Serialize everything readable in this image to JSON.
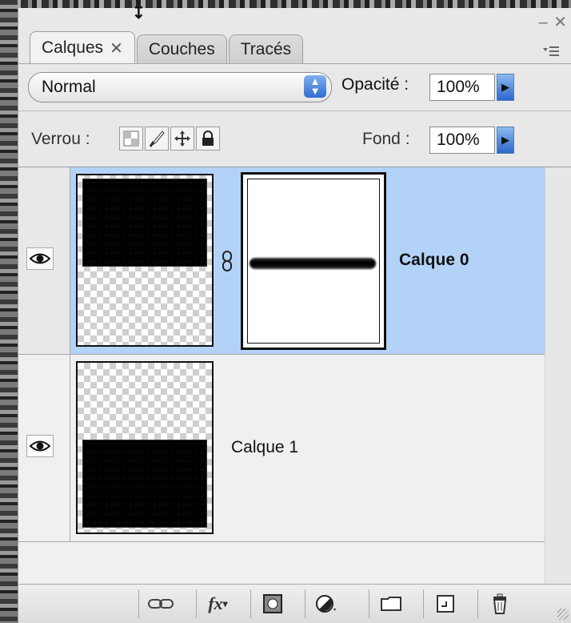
{
  "panel": {
    "tabs": [
      {
        "label": "Calques",
        "close": "✕",
        "active": true
      },
      {
        "label": "Couches",
        "active": false
      },
      {
        "label": "Tracés",
        "active": false
      }
    ],
    "window_controls": {
      "minimize": "–",
      "close": "✕"
    },
    "menu_icon": "panel-menu-icon"
  },
  "blend_mode": {
    "value": "Normal"
  },
  "opacity": {
    "label": "Opacité :",
    "value": "100%"
  },
  "lock": {
    "label": "Verrou :",
    "icons": [
      "lock-transparency-icon",
      "lock-image-brush-icon",
      "lock-position-move-icon",
      "lock-all-padlock-icon"
    ]
  },
  "fill": {
    "label": "Fond :",
    "value": "100%"
  },
  "layers": [
    {
      "name": "Calque 0",
      "selected": true,
      "visible": true,
      "has_mask": true
    },
    {
      "name": "Calque 1",
      "selected": false,
      "visible": true,
      "has_mask": false
    }
  ],
  "footer": {
    "buttons": [
      "link-layers-icon",
      "fx-icon",
      "add-mask-icon",
      "adjustment-layer-icon",
      "new-group-folder-icon",
      "new-layer-icon",
      "trash-icon"
    ],
    "fx_label": "fx"
  },
  "colors": {
    "selection": "#b3d2f7",
    "panel_bg": "#e8e8e8",
    "accent_blue": "#2f6ed4"
  }
}
